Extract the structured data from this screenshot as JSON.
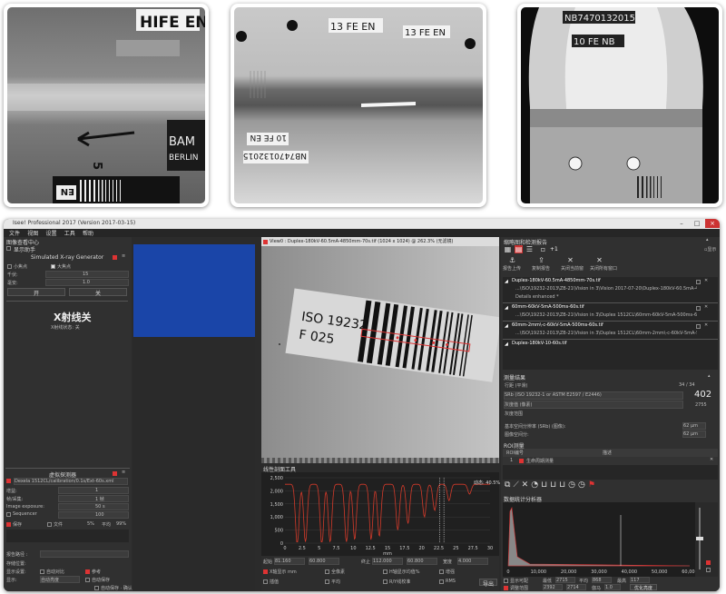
{
  "photos": {
    "weld_left": {
      "marking": "HIFE EN",
      "brand": "BAM",
      "city": "BERLIN",
      "wire": "5",
      "wire_bottom": "EN"
    },
    "weld_middle": {
      "marking_a": "13 FE EN",
      "marking_b": "13 FE EN",
      "marking_c": "10 FE EN",
      "code": "NB7470132015"
    },
    "pipe_right": {
      "code": "NB7470132015",
      "marking": "10 FE NB"
    }
  },
  "window": {
    "title": "Isee! Professional 2017 (Version 2017-03-15)",
    "controls": [
      "–",
      "□",
      "×"
    ],
    "menu": [
      "文件",
      "视图",
      "设置",
      "工具",
      "帮助"
    ]
  },
  "left": {
    "section1": "图像查看中心",
    "show_label": "显示助手",
    "xray_title": "Simulated X-ray Generator",
    "mode_small": "小焦点",
    "mode_large": "大焦点",
    "kv_label": "千伏:",
    "kv_value": "15",
    "ma_label": "毫安:",
    "ma_value": "1.0",
    "on_label": "开",
    "off_label": "关",
    "status_big": "X射线关",
    "status_small": "X射线状态: 关",
    "detector_title": "虚拟探测器",
    "detector_file": "Dexela 1512CL/calibration/0.1s/Ext-60s.xml",
    "binning_label": "增益:",
    "binning_value": "1",
    "frame_label": "帧/采集:",
    "frame_value": "1 帧",
    "exposure_label": "Image exposure:",
    "exposure_value": "50 s",
    "sequencer_label": "Sequencer",
    "sequencer_value": "100",
    "pct1_label": "5%",
    "pct2_label": "平均",
    "pct3_label": "99%",
    "save_label": "保存",
    "x_label": "文件",
    "report_label": "报告路径 :",
    "storage_label": "存储位置:",
    "show_label2": "显示设置:",
    "auto_check": "自动对比",
    "ref_check": "参考",
    "mode_label": "显示:",
    "mode_value": "自动亮度",
    "auto_save": "自动保存",
    "auto_label": "自动保存 · 确认",
    "btn_ok": "确定",
    "btn_open": "打开"
  },
  "blue_panel": {
    "color": "#1a45a8"
  },
  "viewer": {
    "tab_title": "View0 : Duplex-180kV-60.5mA-4850mm-70s.tif (1024 x 1024) @ 262.3% (无滤镜)",
    "plate_line1": "ISO 19232",
    "plate_line2": "F 025"
  },
  "profile": {
    "title": "线性剖面工具",
    "pct_label": "动态: 40.5%",
    "y_ticks": [
      "2,500",
      "2,000",
      "1,500",
      "1,000",
      "500",
      "0"
    ],
    "x_ticks": [
      "0",
      "2.5",
      "5",
      "7.5",
      "10",
      "12.5",
      "15",
      "17.5",
      "20",
      "22.5",
      "25",
      "27.5",
      "30"
    ],
    "x_unit": "mm",
    "fields": [
      {
        "label": "起始",
        "value": "81.160"
      },
      {
        "label": "",
        "value": "60.800"
      },
      {
        "label": "终止",
        "value": "112.000"
      },
      {
        "label": "",
        "value": "60.800"
      },
      {
        "label": "宽度",
        "value": "4.000"
      }
    ],
    "checks": [
      "X轴显示 mm",
      "全像素",
      "H轴显示均值%",
      "增强",
      "插值",
      "平均",
      "R/Y线校准",
      "RMS"
    ],
    "export_label": "导出"
  },
  "right": {
    "title": "缩略图和检测报告",
    "count_label": "+1",
    "icon_labels": [
      "报告上传",
      "复制报告",
      "关闭当前窗",
      "关闭所有窗口"
    ],
    "files": [
      "Duplex-180kV-60.5mA-4850mm-70s.tif",
      "...\\ISO\\19232-2013\\ZB-21\\Vision in 3\\Vision 2017-07-20\\Duplex-180kV-60.5mA-4850mm-70s.tif",
      "Details enhanced *",
      "60mm-60kV-5mA-500ms-60s.tif",
      "...\\ISO\\19232-2013\\ZB-21\\Vision in 3\\Duplex 1512CL\\60mm-60kV-5mA-500ms-60s.tif, image 8",
      "60mm-2mm\\-c-60kV-5mA-500ms-60s.tif",
      "...\\ISO\\19232-2013\\ZB-21\\Vision in 3\\Duplex 1512CL\\60mm-2mm\\-c-60kV-5mA-500ms.tif",
      "Duplex-180kV-10-60s.tif"
    ],
    "measure_title": "测量结果",
    "row1_label": "行距 (平滑)",
    "row1_value": "34 / 34",
    "srb_label": "SRb (ISO 19232-1 or ASTM E2597 / E2446)",
    "srb_value": "402",
    "noise_label": "灰度值 (像素)",
    "noise_value": "2755",
    "range_label": "灰度范围",
    "basic_label": "基本空间分辨率 (SRb) (图像):",
    "basic_value": "62 µm",
    "iqi_label": "图像空间分:",
    "iqi_value": "62 µm",
    "roi_title": "ROI测量",
    "table_head": [
      "ROI编号",
      "描述"
    ],
    "table_row": [
      "1",
      "生命周期测量"
    ],
    "hist_title": "数据统计分析器",
    "hist_x": [
      "0",
      "10,000",
      "20,000",
      "30,000",
      "40,000",
      "50,000",
      "60,000"
    ],
    "foot": [
      {
        "label": "显示可配",
        "value": ""
      },
      {
        "label": "最低",
        "value": "2715"
      },
      {
        "label": "平均",
        "value": "868"
      },
      {
        "label": "最高",
        "value": "117"
      }
    ],
    "foot2": [
      {
        "label": "调整范围",
        "value": "2392"
      },
      {
        "label": "",
        "value": "2714"
      },
      {
        "label": "伽马",
        "value": "1.0"
      },
      {
        "label": "优化亮度",
        "value": ""
      }
    ]
  }
}
